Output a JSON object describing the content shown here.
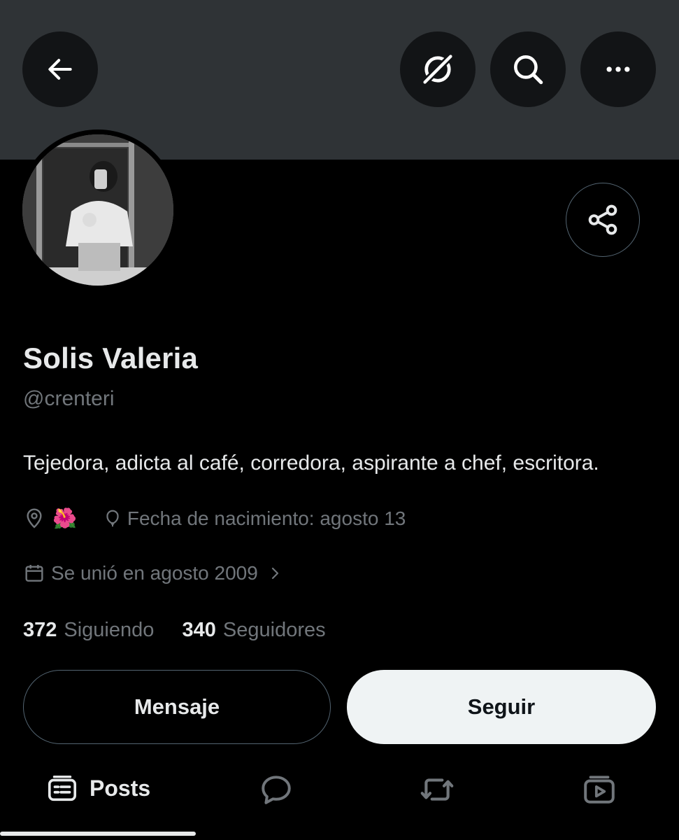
{
  "header": {
    "back_icon": "arrow-left-icon",
    "grok_icon": "grok-icon",
    "search_icon": "search-icon",
    "more_icon": "more-horizontal-icon"
  },
  "profile": {
    "name": "Solis Valeria",
    "handle": "@crenteri",
    "bio": "Tejedora, adicta al café, corredora, aspirante a chef, escritora.",
    "location_emoji": "🌺",
    "birthday": "Fecha de nacimiento: agosto 13",
    "joined": "Se unió en agosto 2009",
    "following_count": "372",
    "following_label": "Siguiendo",
    "followers_count": "340",
    "followers_label": "Seguidores"
  },
  "actions": {
    "message_label": "Mensaje",
    "follow_label": "Seguir",
    "share_icon": "share-icon"
  },
  "tabs": {
    "posts_label": "Posts",
    "active": "Posts"
  },
  "colors": {
    "background": "#000000",
    "banner": "#2f3336",
    "primary_text": "#e7e9ea",
    "secondary_text": "#71767b",
    "follow_button": "#eff3f4"
  }
}
